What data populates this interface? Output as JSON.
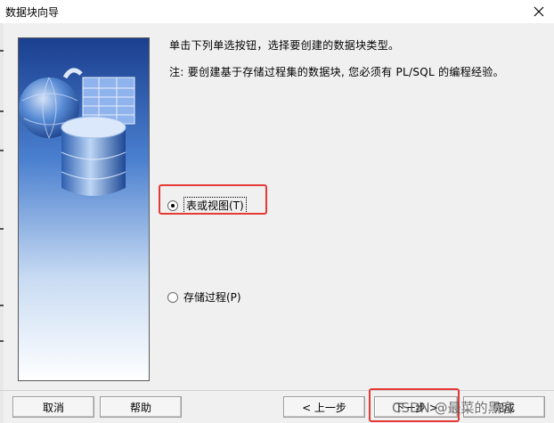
{
  "window": {
    "title": "数据块向导",
    "close_glyph": "✕"
  },
  "content": {
    "instruction": "单击下列单选按钮，选择要创建的数据块类型。",
    "note": "注: 要创建基于存储过程集的数据块, 您必须有 PL/SQL 的编程经验。"
  },
  "options": [
    {
      "label": "表或视图(T)",
      "selected": true
    },
    {
      "label": "存储过程(P)",
      "selected": false
    }
  ],
  "buttons": {
    "cancel": "取消",
    "help": "帮助",
    "back": "< 上一步",
    "next": "下一步 >",
    "finish": "完成"
  },
  "watermark": "CSDN @最菜的黑客",
  "colors": {
    "highlight": "#e53935",
    "image_blue": "#2a5fae"
  }
}
